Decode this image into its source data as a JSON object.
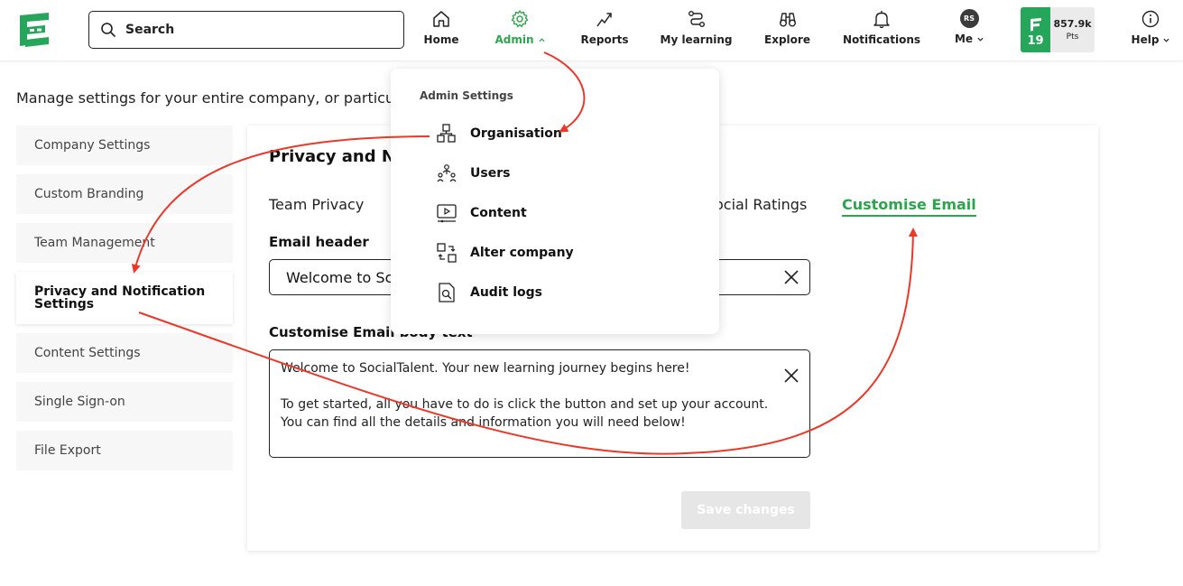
{
  "header": {
    "search_placeholder": "Search",
    "nav": [
      {
        "label": "Home",
        "icon": "home-icon"
      },
      {
        "label": "Admin",
        "icon": "gear-icon",
        "active": true
      },
      {
        "label": "Reports",
        "icon": "trend-up-icon"
      },
      {
        "label": "My learning",
        "icon": "route-icon"
      },
      {
        "label": "Explore",
        "icon": "binoculars-icon"
      },
      {
        "label": "Notifications",
        "icon": "bell-icon"
      },
      {
        "label": "Me",
        "icon": "avatar",
        "initials": "RS"
      },
      {
        "label": "Help",
        "icon": "info-icon"
      }
    ],
    "points": {
      "level": "19",
      "value": "857.9k",
      "unit": "Pts"
    }
  },
  "intro_text": "Manage settings for your entire company, or particu",
  "sidebar": {
    "items": [
      {
        "label": "Company Settings"
      },
      {
        "label": "Custom Branding"
      },
      {
        "label": "Team Management"
      },
      {
        "label": "Privacy and Notification Settings",
        "active": true
      },
      {
        "label": "Content Settings"
      },
      {
        "label": "Single Sign-on"
      },
      {
        "label": "File Export"
      }
    ]
  },
  "panel": {
    "title": "Privacy and No",
    "tabs": [
      {
        "label": "Team Privacy"
      },
      {
        "label": "ocial Ratings"
      },
      {
        "label": "Customise Email",
        "active": true
      }
    ],
    "email_header_label": "Email header",
    "email_header_value": "Welcome to Sc",
    "body_label": "Customise Email body text",
    "body_text": "Welcome to SocialTalent. Your new learning journey begins here!\n\nTo get started, all you have to do is click the button and set up your account. You can find all the details and information you will need below!",
    "save_label": "Save changes"
  },
  "dropdown": {
    "title": "Admin Settings",
    "items": [
      {
        "label": "Organisation",
        "icon": "organisation-icon"
      },
      {
        "label": "Users",
        "icon": "users-icon"
      },
      {
        "label": "Content",
        "icon": "content-icon"
      },
      {
        "label": "Alter company",
        "icon": "alter-company-icon"
      },
      {
        "label": "Audit logs",
        "icon": "audit-logs-icon"
      }
    ]
  },
  "colors": {
    "accent": "#2ea44f",
    "level_badge": "#26a65b",
    "annotation": "#e8392b"
  }
}
